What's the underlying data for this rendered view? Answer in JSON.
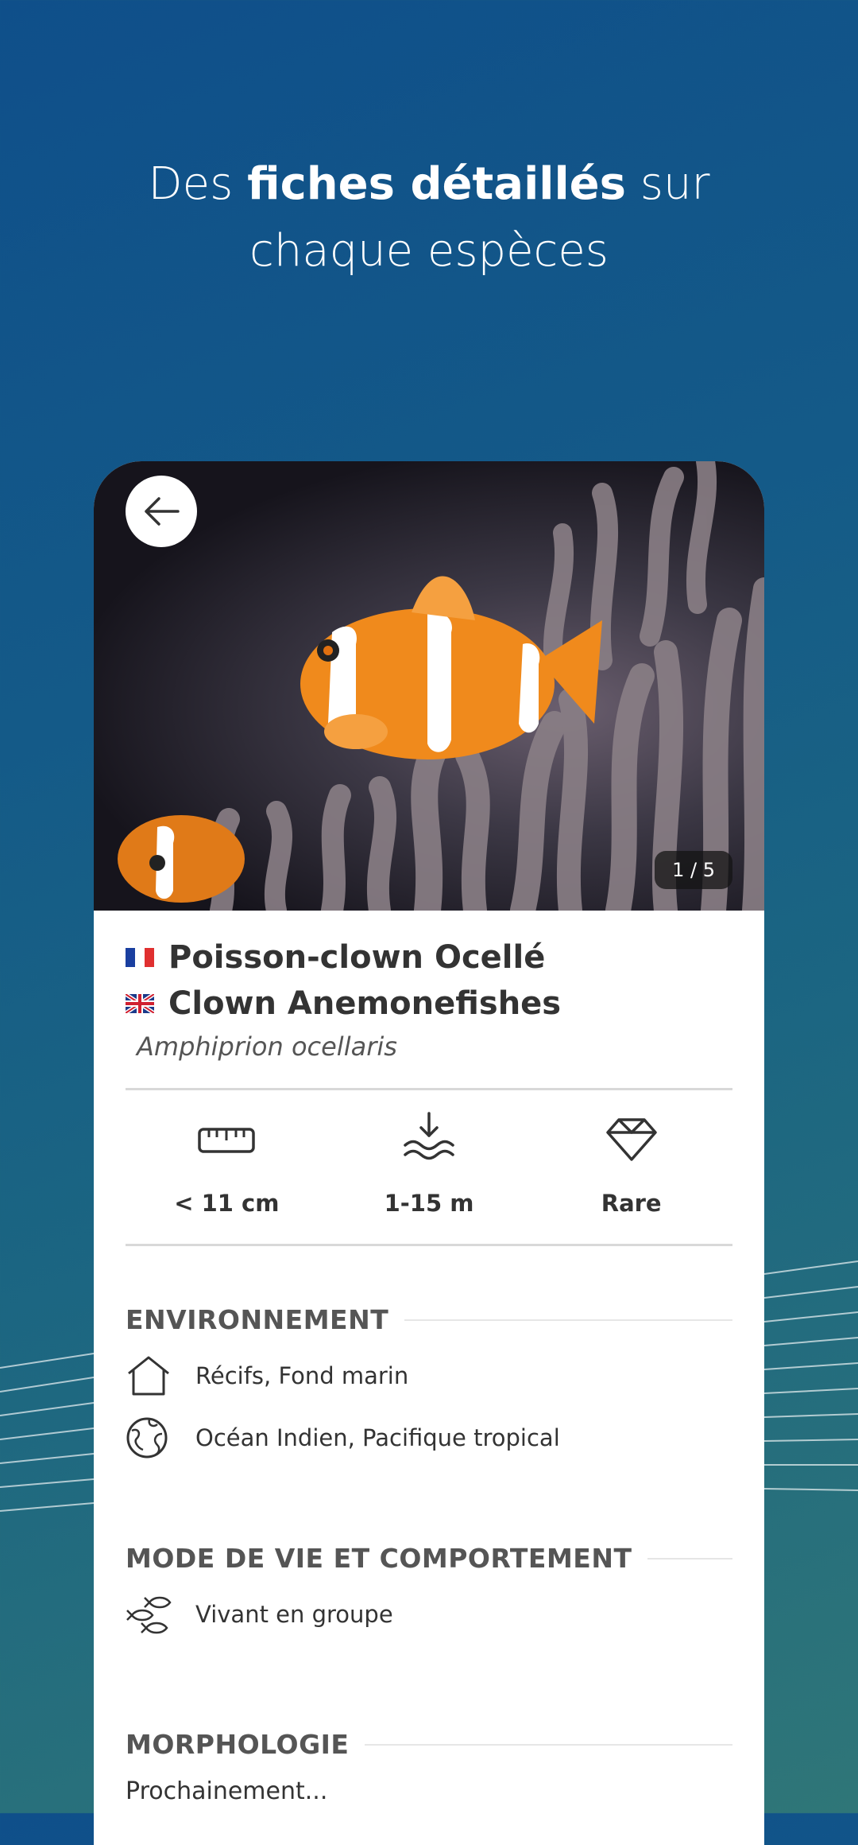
{
  "headline": {
    "pre": "Des ",
    "bold": "fiches détaillés",
    "post": " sur",
    "line2": "chaque espèces"
  },
  "species": {
    "photo_counter": "1 / 5",
    "name_fr": "Poisson-clown Ocellé",
    "name_en": "Clown Anemonefishes",
    "latin": "Amphiprion ocellaris"
  },
  "stats": [
    {
      "icon": "ruler-icon",
      "label": "< 11 cm"
    },
    {
      "icon": "depth-icon",
      "label": "1-15 m"
    },
    {
      "icon": "diamond-icon",
      "label": "Rare"
    }
  ],
  "sections": {
    "environment": {
      "title": "ENVIRONNEMENT",
      "items": [
        {
          "icon": "house-icon",
          "text": "Récifs, Fond marin"
        },
        {
          "icon": "globe-icon",
          "text": "Océan Indien, Pacifique tropical"
        }
      ]
    },
    "behavior": {
      "title": "MODE DE VIE ET COMPORTEMENT",
      "items": [
        {
          "icon": "fish-group-icon",
          "text": "Vivant en groupe"
        }
      ]
    },
    "morphology": {
      "title": "MORPHOLOGIE",
      "text": "Prochainement..."
    }
  },
  "colors": {
    "background": "#145a88",
    "card": "#ffffff",
    "text": "#333333",
    "clownfish": "#f08a1c"
  }
}
